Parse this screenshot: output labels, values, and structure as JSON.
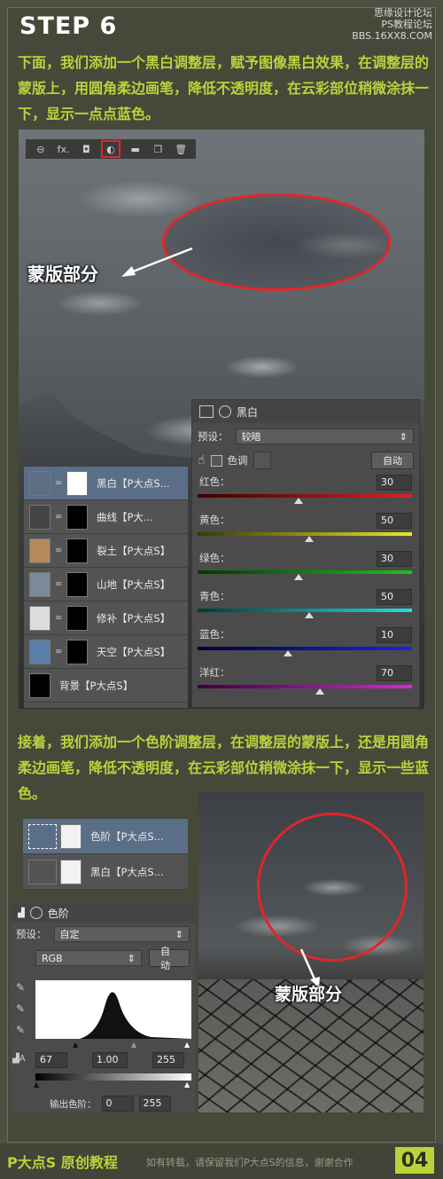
{
  "header": {
    "step_title": "STEP 6",
    "watermark_line1": "思缘设计论坛",
    "watermark_line2": "PS教程论坛",
    "watermark_line3": "BBS.16XX8.COM"
  },
  "intro_text": "下面，我们添加一个黑白调整层，赋予图像黑白效果，在调整层的蒙版上，用圆角柔边画笔，降低不透明度，在云彩部位稍微涂抹一下，显示一点点蓝色。",
  "shot1": {
    "mask_label": "蒙版部分",
    "toolbar": [
      "link-icon",
      "fx-icon",
      "mask-icon",
      "adjustment-icon",
      "folder-icon",
      "new-layer-icon",
      "trash-icon"
    ],
    "fx_label": "fx.",
    "layers": [
      {
        "name": "黑白【P大点S...",
        "selected": true
      },
      {
        "name": "曲线【P大...",
        "selected": false
      },
      {
        "name": "裂土【P大点S】",
        "selected": false
      },
      {
        "name": "山地【P大点S】",
        "selected": false
      },
      {
        "name": "修补【P大点S】",
        "selected": false
      },
      {
        "name": "天空【P大点S】",
        "selected": false
      },
      {
        "name": "背景【P大点S】",
        "selected": false
      }
    ],
    "properties": {
      "title": "黑白",
      "preset_label": "预设：",
      "preset_value": "较暗",
      "tint_label": "色调",
      "auto_label": "自动",
      "sliders": [
        {
          "label": "红色：",
          "value": "30",
          "pos": 0.45,
          "gradient": "linear-gradient(90deg,#3a0000,#e02020)"
        },
        {
          "label": "黄色：",
          "value": "50",
          "pos": 0.5,
          "gradient": "linear-gradient(90deg,#3a3a00,#e8e820)"
        },
        {
          "label": "绿色：",
          "value": "30",
          "pos": 0.45,
          "gradient": "linear-gradient(90deg,#003a00,#20c020)"
        },
        {
          "label": "青色：",
          "value": "50",
          "pos": 0.5,
          "gradient": "linear-gradient(90deg,#003a3a,#20e0e0)"
        },
        {
          "label": "蓝色：",
          "value": "10",
          "pos": 0.4,
          "gradient": "linear-gradient(90deg,#00003a,#2020e0)"
        },
        {
          "label": "洋红：",
          "value": "70",
          "pos": 0.55,
          "gradient": "linear-gradient(90deg,#3a003a,#e020e0)"
        }
      ]
    }
  },
  "second_text": "接着，我们添加一个色阶调整层，在调整层的蒙版上，还是用圆角柔边画笔，降低不透明度，在云彩部位稍微涂抹一下，显示一些蓝色。",
  "shot2": {
    "mask_label": "蒙版部分",
    "layers": [
      {
        "name": "色阶【P大点S...",
        "selected": true
      },
      {
        "name": "黑白【P大点S...",
        "selected": false
      }
    ],
    "levels": {
      "title": "色阶",
      "preset_label": "预设：",
      "preset_value": "自定",
      "channel": "RGB",
      "auto_label": "自动",
      "input_black": "67",
      "input_mid": "1.00",
      "input_white": "255",
      "output_label": "输出色阶：",
      "output_black": "0",
      "output_white": "255"
    }
  },
  "footer": {
    "brand": "P大点S 原创教程",
    "note": "如有转载，请保留我们P大点S的信息，谢谢合作",
    "page": "04"
  },
  "colors": {
    "accent_green": "#b8d43c",
    "highlight_red": "#e0262b"
  }
}
